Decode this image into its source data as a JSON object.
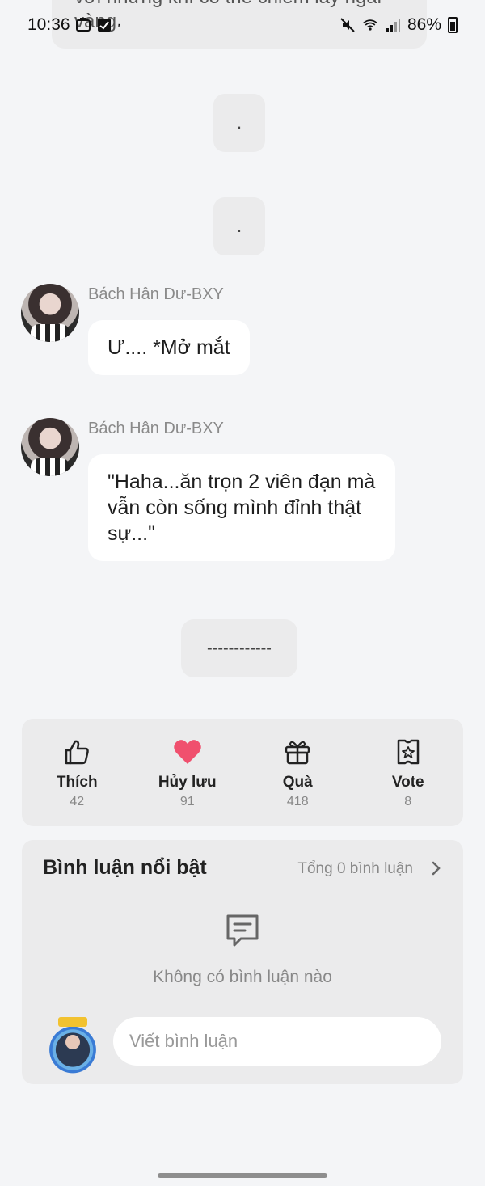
{
  "status_bar": {
    "time": "10:36",
    "battery": "86%"
  },
  "top_bubble": {
    "text": "với những khí có thể chiếm lấy ngai vàng."
  },
  "dot_bubbles": [
    ".",
    "."
  ],
  "messages": [
    {
      "sender": "Bách Hân Dư-BXY",
      "text": "Ư.... *Mở mắt"
    },
    {
      "sender": "Bách Hân Dư-BXY",
      "text": "\"Haha...ăn trọn 2 viên đạn mà vẫn còn sống mình đỉnh thật sự...\""
    }
  ],
  "separator": "------------",
  "actions": [
    {
      "label": "Thích",
      "count": "42",
      "icon": "thumbs-up-icon"
    },
    {
      "label": "Hủy lưu",
      "count": "91",
      "icon": "heart-icon",
      "color": "#f0506e"
    },
    {
      "label": "Quà",
      "count": "418",
      "icon": "gift-icon"
    },
    {
      "label": "Vote",
      "count": "8",
      "icon": "vote-ticket-icon"
    }
  ],
  "comments": {
    "title": "Bình luận nổi bật",
    "total": "Tổng 0 bình luận",
    "empty_text": "Không có bình luận nào",
    "input_placeholder": "Viết bình luận"
  }
}
